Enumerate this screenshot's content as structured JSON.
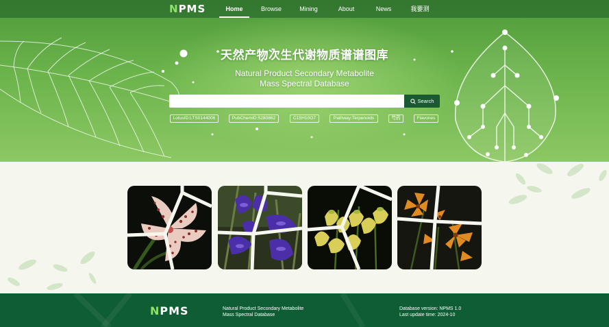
{
  "brand": {
    "logo_text": "NPMS",
    "accent": "#8fe06c",
    "primary": "#195a30"
  },
  "nav": {
    "items": [
      {
        "label": "Home",
        "active": true
      },
      {
        "label": "Browse",
        "active": false
      },
      {
        "label": "Mining",
        "active": false
      },
      {
        "label": "About",
        "active": false
      },
      {
        "label": "News",
        "active": false
      },
      {
        "label": "我要测",
        "active": false
      }
    ]
  },
  "hero": {
    "title_cn": "天然产物次生代谢物质谱谱图库",
    "title_en_line1": "Natural Product Secondary Metabolite",
    "title_en_line2": "Mass Spectral Database"
  },
  "search": {
    "value": "",
    "placeholder": "",
    "button_label": "Search",
    "examples": [
      "LotusID:LTS0144006",
      "PubChemID:5280862",
      "C15H10O7",
      "Pathway:Terpenoids",
      "芍药",
      "Flavones"
    ]
  },
  "gallery": {
    "tiles": [
      {
        "icon": "spotted-orchid-image"
      },
      {
        "icon": "purple-iris-image"
      },
      {
        "icon": "yellow-bell-flower-image"
      },
      {
        "icon": "orange-lily-image"
      }
    ]
  },
  "footer": {
    "logo_text": "NPMS",
    "desc_line1": "Natural Product Secondary Metabolite",
    "desc_line2": "Mass Spectral Database",
    "version": "Database version: NPMS 1.0",
    "update": "Last update time: 2024-10"
  }
}
